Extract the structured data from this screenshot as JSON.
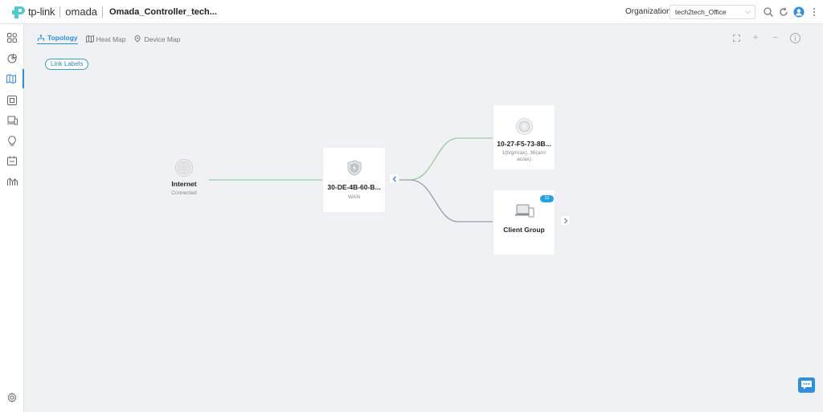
{
  "header": {
    "brand": "tp-link",
    "product": "omada",
    "site_name": "Omada_Controller_tech...",
    "organization_label": "Organization:",
    "organization_value": "tech2tech_Office",
    "icons": [
      "search-icon",
      "refresh-icon",
      "user-avatar-icon",
      "more-icon"
    ]
  },
  "sidebar": {
    "items": [
      {
        "name": "dashboard",
        "icon": "grid-icon"
      },
      {
        "name": "statistics",
        "icon": "pie-chart-icon"
      },
      {
        "name": "map",
        "icon": "map-icon",
        "active": true
      },
      {
        "name": "devices",
        "icon": "device-icon"
      },
      {
        "name": "clients",
        "icon": "clients-icon"
      },
      {
        "name": "insights",
        "icon": "bulb-icon"
      },
      {
        "name": "logs",
        "icon": "calendar-icon"
      },
      {
        "name": "reports",
        "icon": "analytics-icon"
      },
      {
        "name": "settings",
        "icon": "gear-icon"
      }
    ]
  },
  "tabs": [
    {
      "label": "Topology",
      "active": true
    },
    {
      "label": "Heat Map",
      "active": false
    },
    {
      "label": "Device Map",
      "active": false
    }
  ],
  "toolbar": {
    "icons": [
      "fullscreen-icon",
      "zoom-in-icon",
      "zoom-out-icon",
      "info-icon"
    ],
    "zoom_in": "+",
    "zoom_out": "−"
  },
  "link_labels_button": "Link Labels",
  "topology": {
    "internet": {
      "title": "Internet",
      "status": "Connected"
    },
    "gateway": {
      "title": "30-DE-4B-60-B...",
      "sub": "WAN"
    },
    "access_point": {
      "title": "10-27-F5-73-8B...",
      "sub_line1": "1(b/g/n/ax), 36(a/n/",
      "sub_line2": "ac/ax)"
    },
    "client_group": {
      "title": "Client Group",
      "count": "11"
    },
    "link_color": "#8fd19e",
    "link_color_inactive": "#9aa0a6"
  },
  "colors": {
    "accent": "#2b8fe6",
    "badge": "#1fa2e6"
  }
}
